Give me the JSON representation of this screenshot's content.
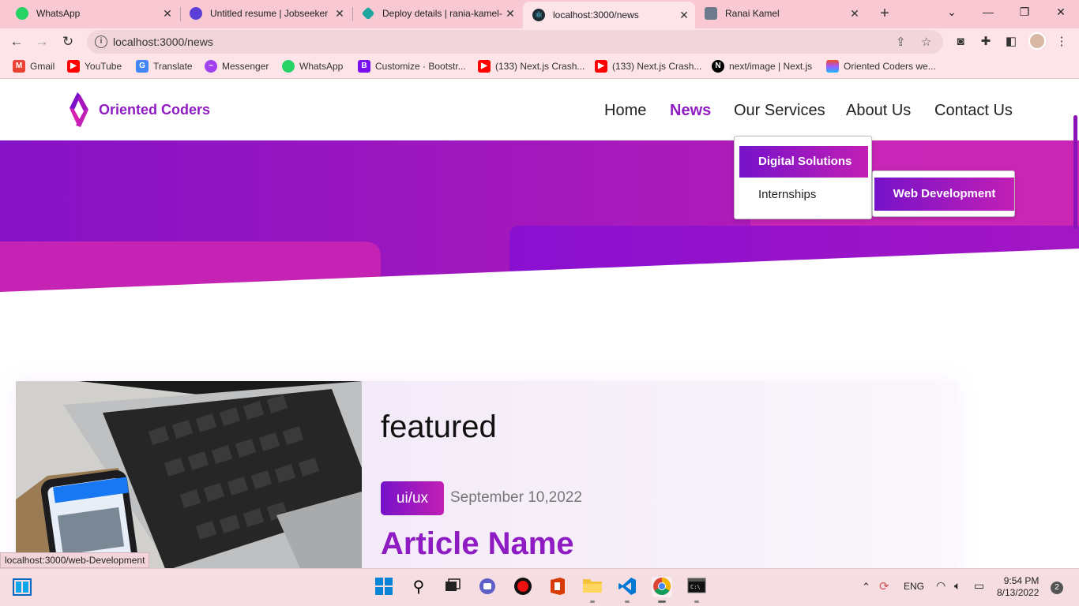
{
  "browser": {
    "tabs": [
      {
        "title": "WhatsApp",
        "icon": "whatsapp-icon"
      },
      {
        "title": "Untitled resume | Jobseeker",
        "icon": "jobseeker-icon"
      },
      {
        "title": "Deploy details | rania-kamel-",
        "icon": "netlify-icon"
      },
      {
        "title": "localhost:3000/news",
        "icon": "react-icon",
        "active": true
      },
      {
        "title": "Ranai Kamel",
        "icon": "figma-icon"
      }
    ],
    "url": "localhost:3000/news",
    "bookmarks": [
      {
        "label": "Gmail",
        "icon": "gmail-icon"
      },
      {
        "label": "YouTube",
        "icon": "youtube-icon"
      },
      {
        "label": "Translate",
        "icon": "translate-icon"
      },
      {
        "label": "Messenger",
        "icon": "messenger-icon"
      },
      {
        "label": "WhatsApp",
        "icon": "whatsapp-icon"
      },
      {
        "label": "Customize · Bootstr...",
        "icon": "bootstrap-icon"
      },
      {
        "label": "(133) Next.js Crash...",
        "icon": "youtube-icon"
      },
      {
        "label": "(133) Next.js Crash...",
        "icon": "youtube-icon"
      },
      {
        "label": "next/image | Next.js",
        "icon": "nextjs-icon"
      },
      {
        "label": "Oriented Coders we...",
        "icon": "figma-icon"
      }
    ],
    "status_url": "localhost:3000/web-Development"
  },
  "site": {
    "brand": "Oriented Coders",
    "nav": {
      "home": "Home",
      "news": "News",
      "services": "Our Services",
      "about": "About Us",
      "contact": "Contact Us"
    },
    "dropdown": {
      "digital": "Digital Solutions",
      "internships": "Internships",
      "web_dev": "Web Development"
    },
    "card": {
      "heading": "featured",
      "tag": "ui/ux",
      "date": "September 10,2022",
      "title": "Article Name"
    },
    "colors": {
      "primary": "#8f1bc2",
      "gradient_start": "#7612c9",
      "gradient_end": "#c21fb5"
    }
  },
  "taskbar": {
    "language": "ENG",
    "time": "9:54 PM",
    "date": "8/13/2022",
    "notifications": "2"
  }
}
